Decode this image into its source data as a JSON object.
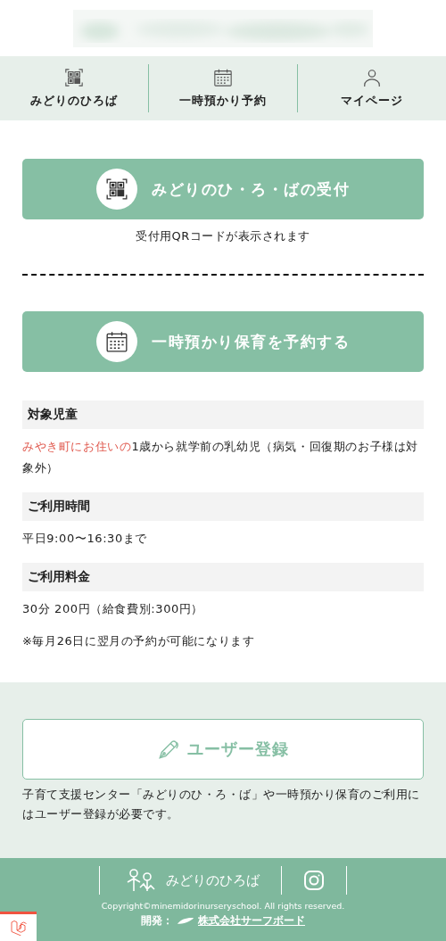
{
  "nav": [
    {
      "label": "みどりのひろば",
      "kind": "qr"
    },
    {
      "label": "一時預かり予約",
      "kind": "calendar"
    },
    {
      "label": "マイページ",
      "kind": "person"
    }
  ],
  "actions": [
    {
      "label": "みどりのひ・ろ・ばの受付",
      "kind": "qr",
      "note": "受付用QRコードが表示されます"
    },
    {
      "label": "一時預かり保育を予約する",
      "kind": "calendar"
    }
  ],
  "info": [
    {
      "heading": "対象児童",
      "text": "**みやき町にお住いの**1歳から就学前の乳幼児（病気・回復期のお子様は対象外）"
    },
    {
      "heading": "ご利用時間",
      "text": "平日9:00〜16:30まで"
    },
    {
      "heading": "ご利用料金",
      "text": "30分 200円（給食費別:300円）"
    }
  ],
  "notice": "※毎月26日に翌月の予約が可能になります",
  "register": {
    "label": "ユーザー登録",
    "description": "子育て支援センター「みどりのひ・ろ・ば」や一時預かり保育のご利用にはユーザー登録が必要です。"
  },
  "footer": {
    "logo_text": "みどりのひろば",
    "copyright": "Copyright©minemidorinurseryschool. All rights reserved.",
    "developer_label": "開発：",
    "developer_link": "株式会社サーフボード"
  }
}
